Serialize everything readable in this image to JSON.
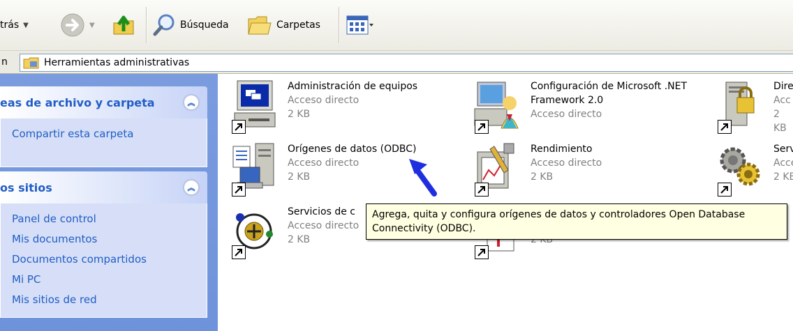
{
  "toolbar": {
    "back_label": "trás",
    "search_label": "Búsqueda",
    "folders_label": "Carpetas"
  },
  "address": {
    "label": "n",
    "path": "Herramientas administrativas"
  },
  "sidebar": {
    "panels": [
      {
        "title": "eas de archivo y carpeta",
        "links": [
          "Compartir esta carpeta"
        ]
      },
      {
        "title": "os sitios",
        "links": [
          "Panel de control",
          "Mis documentos",
          "Documentos compartidos",
          "Mi PC",
          "Mis sitios de red"
        ]
      }
    ]
  },
  "items": [
    {
      "name": "Administración de equipos",
      "type": "Acceso directo",
      "size": "2 KB",
      "icon": "computer-management-icon"
    },
    {
      "name": "Configuración de Microsoft .NET",
      "name2": "Framework 2.0",
      "type": "Acceso directo",
      "size": "",
      "icon": "net-config-icon"
    },
    {
      "name": "Dire",
      "type": "Acc",
      "size": "2 KB",
      "icon": "directory-lock-icon"
    },
    {
      "name": "Orígenes de datos (ODBC)",
      "type": "Acceso directo",
      "size": "2 KB",
      "icon": "odbc-icon"
    },
    {
      "name": "Rendimiento",
      "type": "Acceso directo",
      "size": "2 KB",
      "icon": "performance-icon"
    },
    {
      "name": "Serv",
      "type": "Acce",
      "size": "2 KB",
      "icon": "services-icon"
    },
    {
      "name": "Servicios de c",
      "type": "Acceso directo",
      "size": "2 KB",
      "icon": "component-services-icon"
    },
    {
      "name": "",
      "type": "",
      "size": "2 KB",
      "icon": "event-viewer-icon"
    }
  ],
  "tooltip": {
    "line1": "Agrega, quita y configura orígenes de datos y controladores Open Database",
    "line2": "Connectivity (ODBC)."
  },
  "colors": {
    "sidebar_bg": "#7a9cdf",
    "panel_body": "#d6dff7",
    "link": "#215dc6",
    "tooltip_bg": "#ffffe1",
    "annotation_arrow": "#1f2fe0"
  }
}
